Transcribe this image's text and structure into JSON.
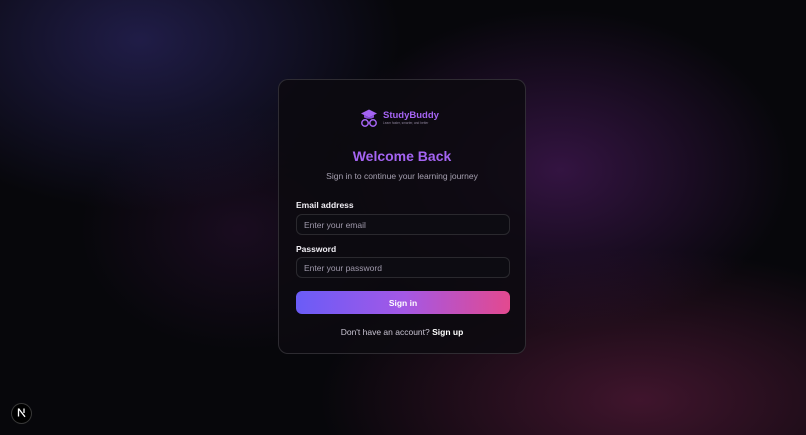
{
  "brand": {
    "name": "StudyBuddy",
    "tagline": "Learn faster, smarter, and better",
    "icon": "graduation-cap-glasses-icon",
    "color": "#a464f2"
  },
  "login": {
    "title": "Welcome Back",
    "subtitle": "Sign in to continue your learning journey",
    "email": {
      "label": "Email address",
      "placeholder": "Enter your email",
      "value": ""
    },
    "password": {
      "label": "Password",
      "placeholder": "Enter your password",
      "value": ""
    },
    "submit_label": "Sign in",
    "footer_text": "Don't have an account?",
    "signup_label": "Sign up"
  },
  "dev_badge": {
    "letter": "N",
    "icon": "nextjs-logo-icon"
  },
  "colors": {
    "accent": "#a464f2",
    "button_gradient_start": "#6a5cf7",
    "button_gradient_end": "#e3498f"
  }
}
